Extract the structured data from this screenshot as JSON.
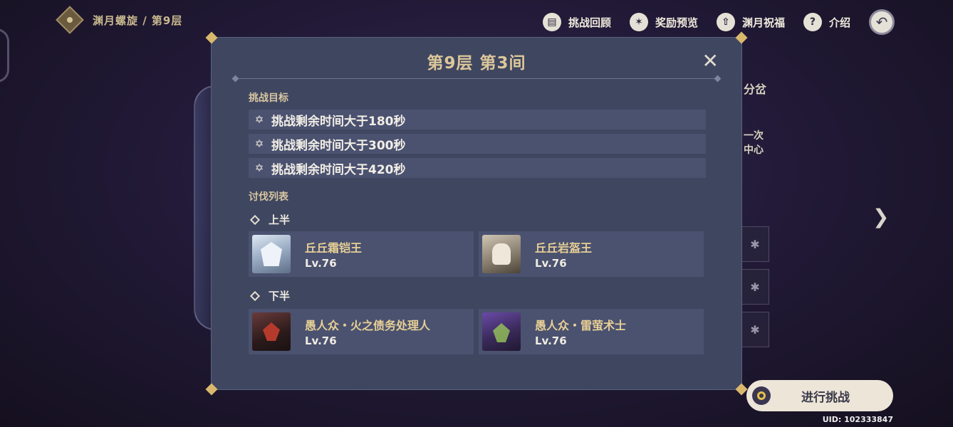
{
  "header": {
    "breadcrumb": "渊月螺旋 / 第9层",
    "buttons": [
      {
        "label": "挑战回顾",
        "icon": "book-icon"
      },
      {
        "label": "奖励预览",
        "icon": "star-badge-icon"
      },
      {
        "label": "渊月祝福",
        "icon": "upload-arrow-icon"
      },
      {
        "label": "介绍",
        "icon": "question-icon"
      }
    ]
  },
  "background": {
    "fragment_1": "分岔",
    "fragment_2": "一次",
    "fragment_3": "中心"
  },
  "modal": {
    "title": "第9层 第3间",
    "goals_label": "挑战目标",
    "goals": [
      "挑战剩余时间大于180秒",
      "挑战剩余时间大于300秒",
      "挑战剩余时间大于420秒"
    ],
    "enemy_list_label": "讨伐列表",
    "first_half": {
      "label": "上半",
      "enemies": [
        {
          "name": "丘丘霜铠王",
          "level": "Lv.76"
        },
        {
          "name": "丘丘岩盔王",
          "level": "Lv.76"
        }
      ]
    },
    "second_half": {
      "label": "下半",
      "enemies": [
        {
          "name": "愚人众・火之债务处理人",
          "level": "Lv.76"
        },
        {
          "name": "愚人众・雷萤术士",
          "level": "Lv.76"
        }
      ]
    }
  },
  "start_button": {
    "label": "进行挑战"
  },
  "uid": "UID: 102333847",
  "colors": {
    "accent_gold": "#dcc79a",
    "modal_bg": "#3f4660",
    "row_bg": "#4b5270"
  }
}
